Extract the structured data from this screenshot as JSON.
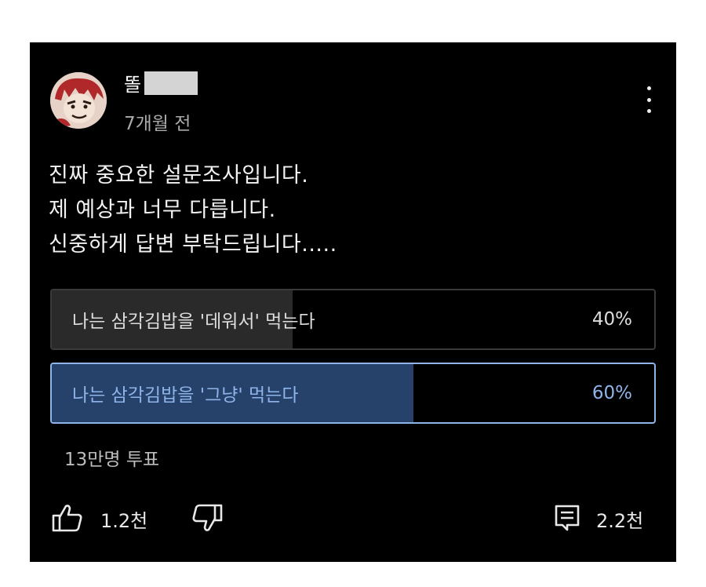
{
  "post": {
    "author": "똘",
    "time": "7개월 전",
    "text_lines": [
      "진짜 중요한 설문조사입니다.",
      "제 예상과 너무 다릅니다.",
      "신중하게 답변 부탁드립니다....."
    ]
  },
  "poll": {
    "options": [
      {
        "label": "나는 삼각김밥을 '데워서' 먹는다",
        "percent_text": "40%",
        "percent": 40,
        "selected": false
      },
      {
        "label": "나는 삼각김밥을 '그냥' 먹는다",
        "percent_text": "60%",
        "percent": 60,
        "selected": true
      }
    ],
    "votes": "13만명 투표"
  },
  "actions": {
    "likes": "1.2천",
    "comments": "2.2천"
  },
  "icons": {
    "menu": "kebab-menu-icon",
    "like": "thumbs-up-icon",
    "dislike": "thumbs-down-icon",
    "comment": "comment-icon"
  },
  "colors": {
    "background": "#000000",
    "accent": "#8fb4ea",
    "selected_fill": "#26416a",
    "unselected_fill": "#2a2a2a"
  }
}
